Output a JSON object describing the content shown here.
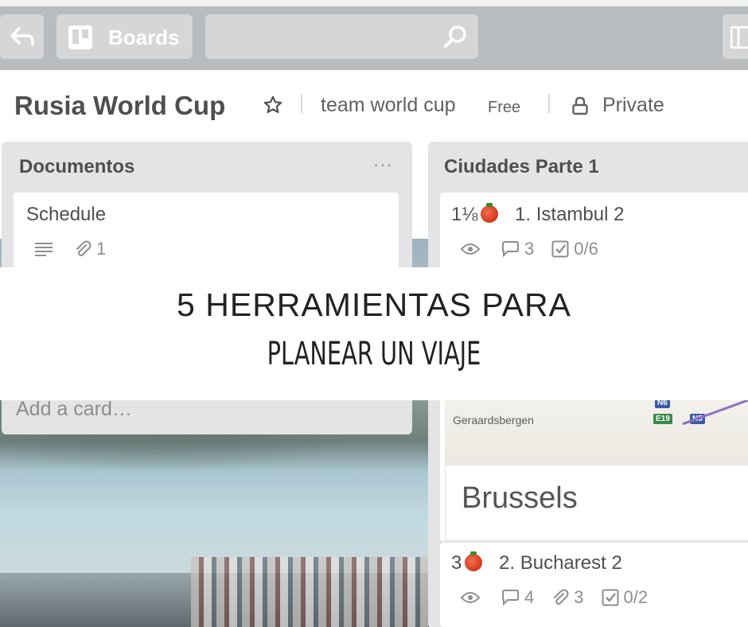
{
  "topbar": {
    "boards_label": "Boards",
    "search_placeholder": ""
  },
  "board": {
    "title": "Rusia World Cup",
    "team": "team world cup",
    "plan": "Free",
    "visibility": "Private"
  },
  "lists": [
    {
      "title": "Documentos",
      "menu": "···",
      "cards": [
        {
          "title": "Schedule",
          "attachments": "1"
        }
      ],
      "add_card": "Add a card…"
    },
    {
      "title": "Ciudades Parte 1",
      "cards": [
        {
          "votes": "1⅛",
          "title": "1. Istambul 2",
          "comments": "3",
          "checklist": "0/6"
        },
        {
          "map_place": "Geraardsbergen",
          "map_tags": [
            "N6",
            "E19",
            "N5"
          ],
          "title": "Brussels"
        },
        {
          "votes": "3",
          "title": "2. Bucharest 2",
          "comments": "4",
          "attachments": "3",
          "checklist": "0/2"
        }
      ]
    }
  ],
  "banner": {
    "line1": "5 HERRAMIENTAS PARA",
    "line2": "PLANEAR UN VIAJE"
  },
  "colors": {
    "topbar": "#b8bcbf",
    "list_bg": "#e2e4e6",
    "text": "#4d4f52",
    "muted": "#8b8e91"
  }
}
